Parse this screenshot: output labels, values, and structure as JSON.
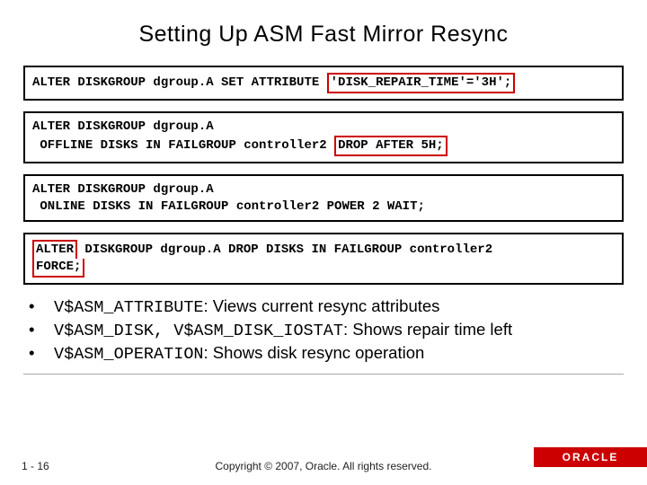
{
  "title": "Setting Up ASM Fast Mirror Resync",
  "code": {
    "box1": {
      "pre": "ALTER DISKGROUP dgroup.A SET ATTRIBUTE ",
      "hl": "'DISK_REPAIR_TIME'='3H';"
    },
    "box2": {
      "line1": "ALTER DISKGROUP dgroup.A",
      "line2a": " OFFLINE DISKS IN FAILGROUP controller2 ",
      "hl": "DROP AFTER 5H;"
    },
    "box3": {
      "line1": "ALTER DISKGROUP dgroup.A",
      "line2": " ONLINE DISKS IN FAILGROUP controller2 POWER 2 WAIT;"
    },
    "box4": {
      "top_hl": "ALTER",
      "top_rest": " DISKGROUP dgroup.A DROP DISKS IN FAILGROUP controller2",
      "bot_hl": "FORCE;"
    }
  },
  "bullets": {
    "b1": {
      "code": "V$ASM_ATTRIBUTE",
      "rest": ": Views current resync attributes"
    },
    "b2": {
      "code": "V$ASM_DISK, V$ASM_DISK_IOSTAT",
      "rest": ": Shows repair time left"
    },
    "b3": {
      "code": "V$ASM_OPERATION",
      "rest": ": Shows disk resync operation"
    }
  },
  "footer": {
    "page": "1 - 16",
    "copyright": "Copyright © 2007, Oracle. All rights reserved.",
    "brand": "ORACLE"
  }
}
